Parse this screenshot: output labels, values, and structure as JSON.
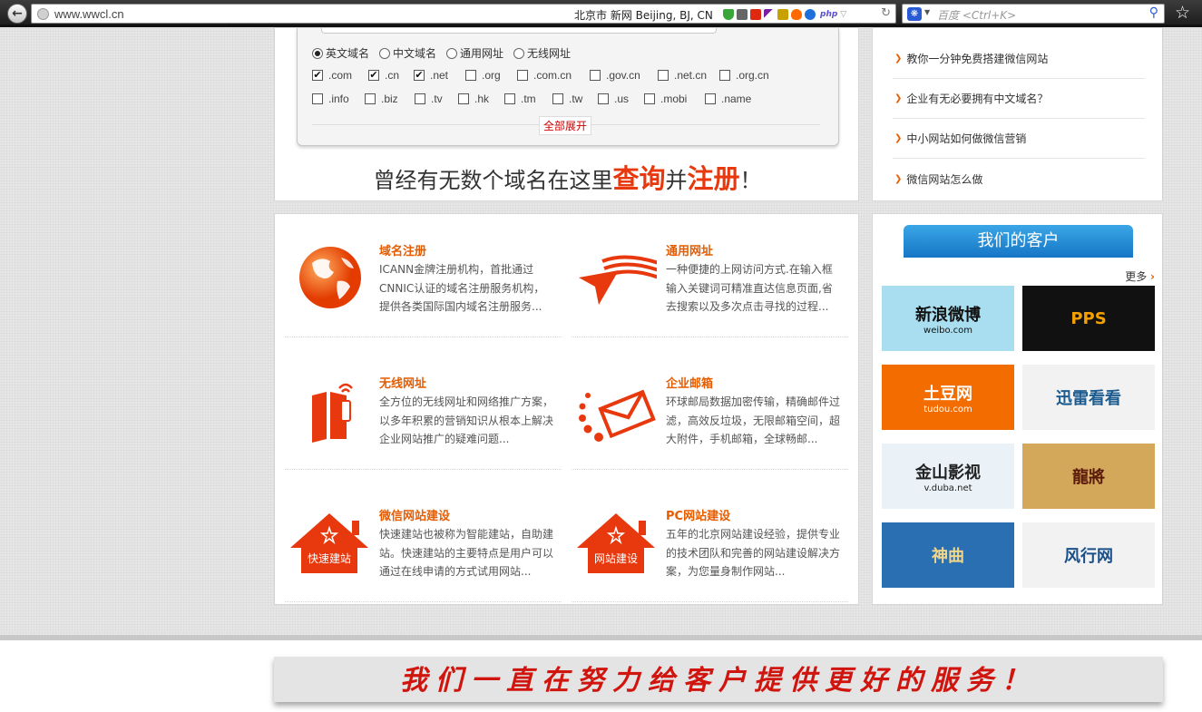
{
  "browser": {
    "url": "www.wwcl.cn",
    "weather": "北京市 新网    Beijing, BJ, CN",
    "search_placeholder": "百度 <Ctrl+K>"
  },
  "domain_search": {
    "types": [
      {
        "label": "英文域名",
        "selected": true
      },
      {
        "label": "中文域名",
        "selected": false
      },
      {
        "label": "通用网址",
        "selected": false
      },
      {
        "label": "无线网址",
        "selected": false
      }
    ],
    "extensions_row1": [
      {
        "label": ".com",
        "checked": true
      },
      {
        "label": ".cn",
        "checked": true
      },
      {
        "label": ".net",
        "checked": true
      },
      {
        "label": ".org",
        "checked": false
      },
      {
        "label": ".com.cn",
        "checked": false
      },
      {
        "label": ".gov.cn",
        "checked": false
      },
      {
        "label": ".net.cn",
        "checked": false
      },
      {
        "label": ".org.cn",
        "checked": false
      }
    ],
    "extensions_row2": [
      {
        "label": ".info",
        "checked": false
      },
      {
        "label": ".biz",
        "checked": false
      },
      {
        "label": ".tv",
        "checked": false
      },
      {
        "label": ".hk",
        "checked": false
      },
      {
        "label": ".tm",
        "checked": false
      },
      {
        "label": ".tw",
        "checked": false
      },
      {
        "label": ".us",
        "checked": false
      },
      {
        "label": ".mobi",
        "checked": false
      },
      {
        "label": ".name",
        "checked": false
      }
    ],
    "expand_label": "全部展开",
    "slogan_a": "曾经有无数个域名在这里",
    "slogan_b": "查询",
    "slogan_c": "并",
    "slogan_d": "注册",
    "slogan_e": "！"
  },
  "news": [
    "教你一分钟免费搭建微信网站",
    "企业有无必要拥有中文域名？",
    "中小网站如何做微信营销",
    "微信网站怎么做"
  ],
  "services": [
    {
      "title": "域名注册",
      "icon": "globe-icon",
      "desc": [
        "ICANN金牌注册机构，首批通过",
        "CNNIC认证的域名注册服务机构，",
        "提供各类国际国内域名注册服务..."
      ]
    },
    {
      "title": "通用网址",
      "icon": "cursor-arrow-icon",
      "desc": [
        "一种便捷的上网访问方式.在输入框",
        "输入关键词可精准直达信息页面,省",
        "去搜索以及多次点击寻找的过程..."
      ]
    },
    {
      "title": "无线网址",
      "icon": "mobile-phone-icon",
      "desc": [
        "全方位的无线网址和网络推广方案，",
        "以多年积累的营销知识从根本上解决",
        "企业网站推广的疑难问题..."
      ]
    },
    {
      "title": "企业邮箱",
      "icon": "envelope-icon",
      "desc": [
        "环球邮局数据加密传输，精确邮件过",
        "滤，高效反垃圾，无限邮箱空间，超",
        "大附件，手机邮箱，全球畅邮..."
      ]
    },
    {
      "title": "微信网站建设",
      "icon": "house-icon",
      "house_text": "快速建站",
      "desc": [
        "快速建站也被称为智能建站，自助建",
        "站。快速建站的主要特点是用户可以",
        "通过在线申请的方式试用网站..."
      ]
    },
    {
      "title": "PC网站建设",
      "icon": "house-icon",
      "house_text": "网站建设",
      "desc": [
        "五年的北京网站建设经验，提供专业",
        "的技术团队和完善的网站建设解决方",
        "案，为您量身制作网站..."
      ]
    }
  ],
  "clients": {
    "title": "我们的客户",
    "more": "更多",
    "logos": [
      {
        "name": "新浪微博",
        "sub": "weibo.com",
        "bg": "#a8def0",
        "fg": "#111"
      },
      {
        "name": "PPS",
        "sub": "",
        "bg": "#111111",
        "fg": "#f5a000"
      },
      {
        "name": "土豆网",
        "sub": "tudou.com",
        "bg": "#f36c00",
        "fg": "#ffffff"
      },
      {
        "name": "迅雷看看",
        "sub": "",
        "bg": "#f2f2f2",
        "fg": "#1c5b8f"
      },
      {
        "name": "金山影视",
        "sub": "v.duba.net",
        "bg": "#eaf1f7",
        "fg": "#222"
      },
      {
        "name": "龍將",
        "sub": "",
        "bg": "#d3a85b",
        "fg": "#5a1a0a"
      },
      {
        "name": "神曲",
        "sub": "",
        "bg": "#2b6fb3",
        "fg": "#f0d68a"
      },
      {
        "name": "风行网",
        "sub": "",
        "bg": "#f2f2f2",
        "fg": "#1a4f8a"
      }
    ]
  },
  "bottom_banner": "我们一直在努力给客户提供更好的服务！"
}
